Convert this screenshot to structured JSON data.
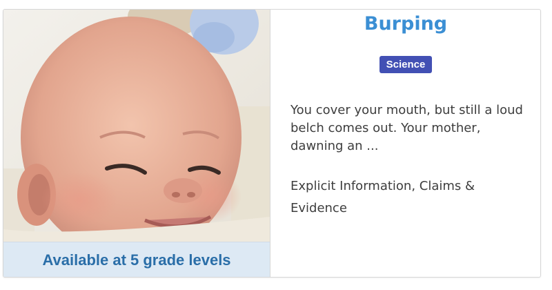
{
  "card": {
    "title": "Burping",
    "subject_badge": "Science",
    "summary": "You cover your mouth, but still a loud belch comes out. Your mother, dawning an ...",
    "skills": "Explicit Information, Claims & Evidence",
    "grade_levels_label": "Available at 5 grade levels",
    "image_subject": "smiling newborn baby photo",
    "colors": {
      "title": "#3b8fd4",
      "badge_bg": "#4250b4",
      "banner_bg": "#dde9f4",
      "banner_text": "#2a6ea8"
    }
  }
}
